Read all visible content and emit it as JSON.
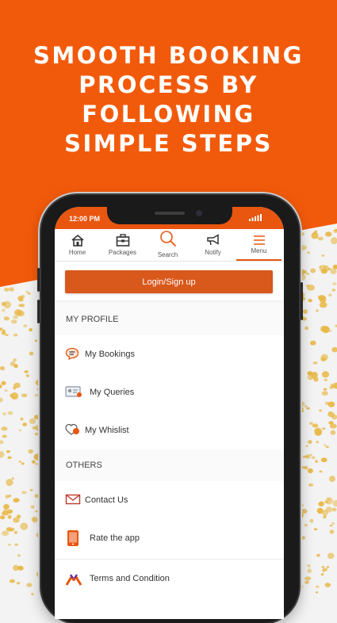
{
  "headline": {
    "lines": [
      "SMOOTH BOOKING",
      "PROCESS BY",
      "FOLLOWING",
      "SIMPLE STEPS"
    ]
  },
  "colors": {
    "accent": "#e8560f",
    "button": "#d9581c",
    "background": "#f3f3f3",
    "confetti": "#e8b94a"
  },
  "status_bar": {
    "time": "12:00 PM"
  },
  "tabs": [
    {
      "label": "Home",
      "icon": "home-icon"
    },
    {
      "label": "Packages",
      "icon": "packages-icon"
    },
    {
      "label": "Search",
      "icon": "search-icon"
    },
    {
      "label": "Notify",
      "icon": "megaphone-icon"
    },
    {
      "label": "Menu",
      "icon": "hamburger-menu-icon",
      "active": true
    }
  ],
  "login_button": "Login/Sign up",
  "sections": {
    "profile": "MY PROFILE",
    "others": "OTHERS"
  },
  "profile_items": [
    {
      "label": "My Bookings",
      "icon": "chat-bubble-icon"
    },
    {
      "label": "My Queries",
      "icon": "id-card-icon"
    },
    {
      "label": "My Whislist",
      "icon": "heart-icon"
    }
  ],
  "other_items": [
    {
      "label": "Contact Us",
      "icon": "envelope-icon"
    },
    {
      "label": "Rate the app",
      "icon": "phone-rate-icon"
    },
    {
      "label": "Terms and Condition",
      "icon": "handshake-icon"
    }
  ]
}
